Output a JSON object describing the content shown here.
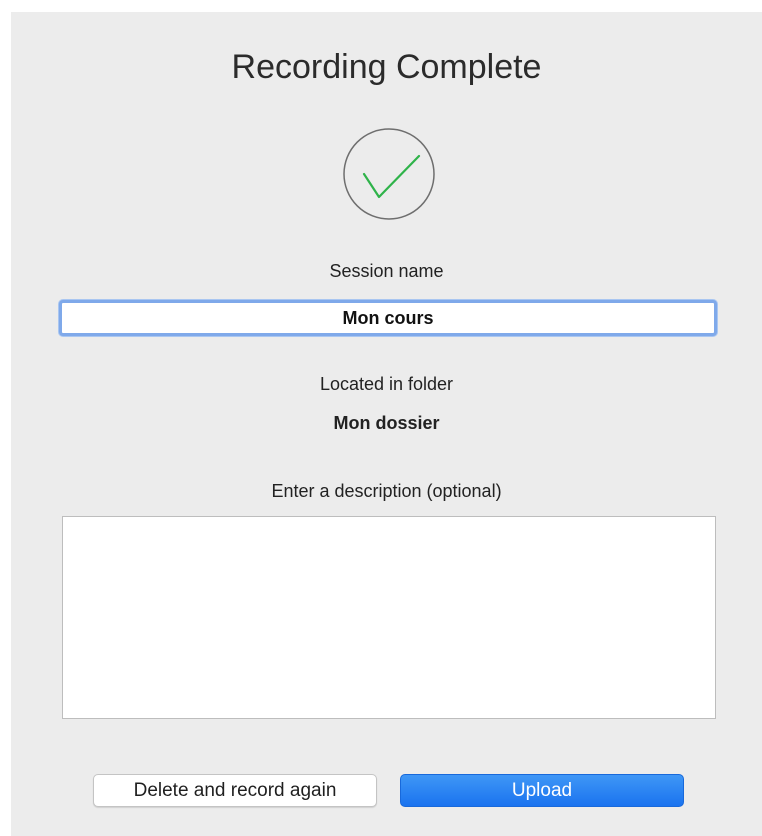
{
  "dialog": {
    "title": "Recording Complete",
    "status_icon": "check-icon",
    "session": {
      "label": "Session name",
      "value": "Mon cours"
    },
    "folder": {
      "label": "Located in folder",
      "name": "Mon dossier"
    },
    "description": {
      "label": "Enter a description (optional)",
      "value": ""
    },
    "buttons": {
      "delete_label": "Delete and record again",
      "upload_label": "Upload"
    }
  },
  "colors": {
    "background": "#ececec",
    "check": "#2fb34a",
    "circle": "#6e6e6e",
    "focus_ring": "#7fa9ea",
    "primary": "#1a73ef"
  }
}
